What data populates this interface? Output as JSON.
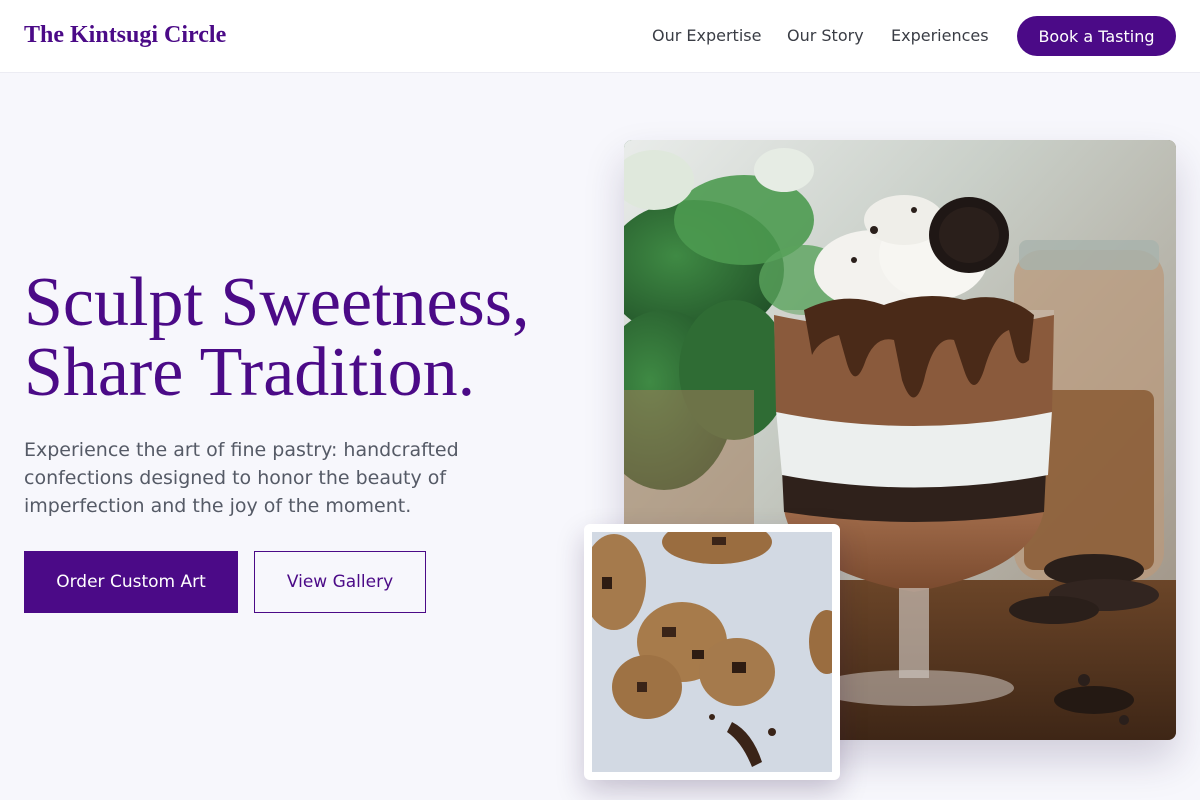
{
  "brand": {
    "name": "The Kintsugi Circle"
  },
  "nav": {
    "links": [
      "Our Expertise",
      "Our Story",
      "Experiences"
    ],
    "cta_label": "Book a Tasting"
  },
  "hero": {
    "headline_line1": "Sculpt Sweetness,",
    "headline_line2": "Share Tradition.",
    "description": "Experience the art of fine pastry: handcrafted confections designed to honor the beauty of imperfection and the joy of the moment.",
    "primary_button": "Order Custom Art",
    "secondary_button": "View Gallery"
  },
  "colors": {
    "accent": "#4b0a87",
    "background": "#f7f7fc",
    "body_text": "#555a66"
  },
  "images": {
    "main": "chocolate-parfait-dessert-photo",
    "secondary": "chocolate-chip-cookies-photo"
  }
}
